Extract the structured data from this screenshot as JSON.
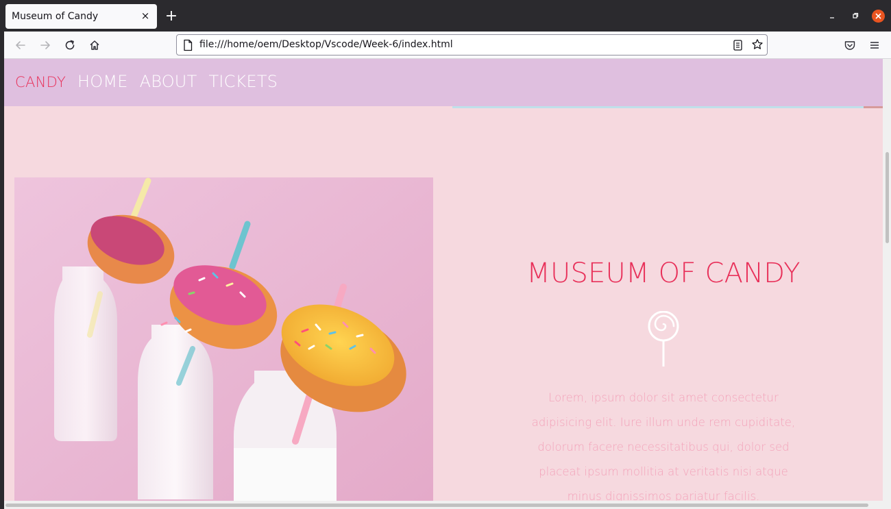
{
  "browser": {
    "tab_title": "Museum of Candy",
    "tab_close": "×",
    "new_tab": "+",
    "url": "file:///home/oem/Desktop/Vscode/Week-6/index.html"
  },
  "site": {
    "brand": "CANDY",
    "nav": [
      "HOME",
      "ABOUT",
      "TICKETS"
    ],
    "hero_title": "MUSEUM OF CANDY",
    "hero_text": "Lorem, ipsum dolor sit amet consectetur adipisicing elit. Iure illum unde rem cupiditate, dolorum facere necessitatibus qui, dolor sed placeat ipsum mollitia at veritatis nisi atque minus dignissimos pariatur facilis."
  },
  "colors": {
    "header_bg": "#dfbfdf",
    "page_bg": "#f6d9df",
    "brand": "#e8315a",
    "hero_text": "#f3a3ba"
  },
  "icons": {
    "back": "arrow-left-icon",
    "forward": "arrow-right-icon",
    "reload": "reload-icon",
    "home": "home-icon",
    "page": "page-icon",
    "reader": "reader-view-icon",
    "bookmark": "star-icon",
    "pocket": "pocket-icon",
    "menu": "hamburger-menu-icon",
    "lollipop": "lollipop-icon"
  }
}
